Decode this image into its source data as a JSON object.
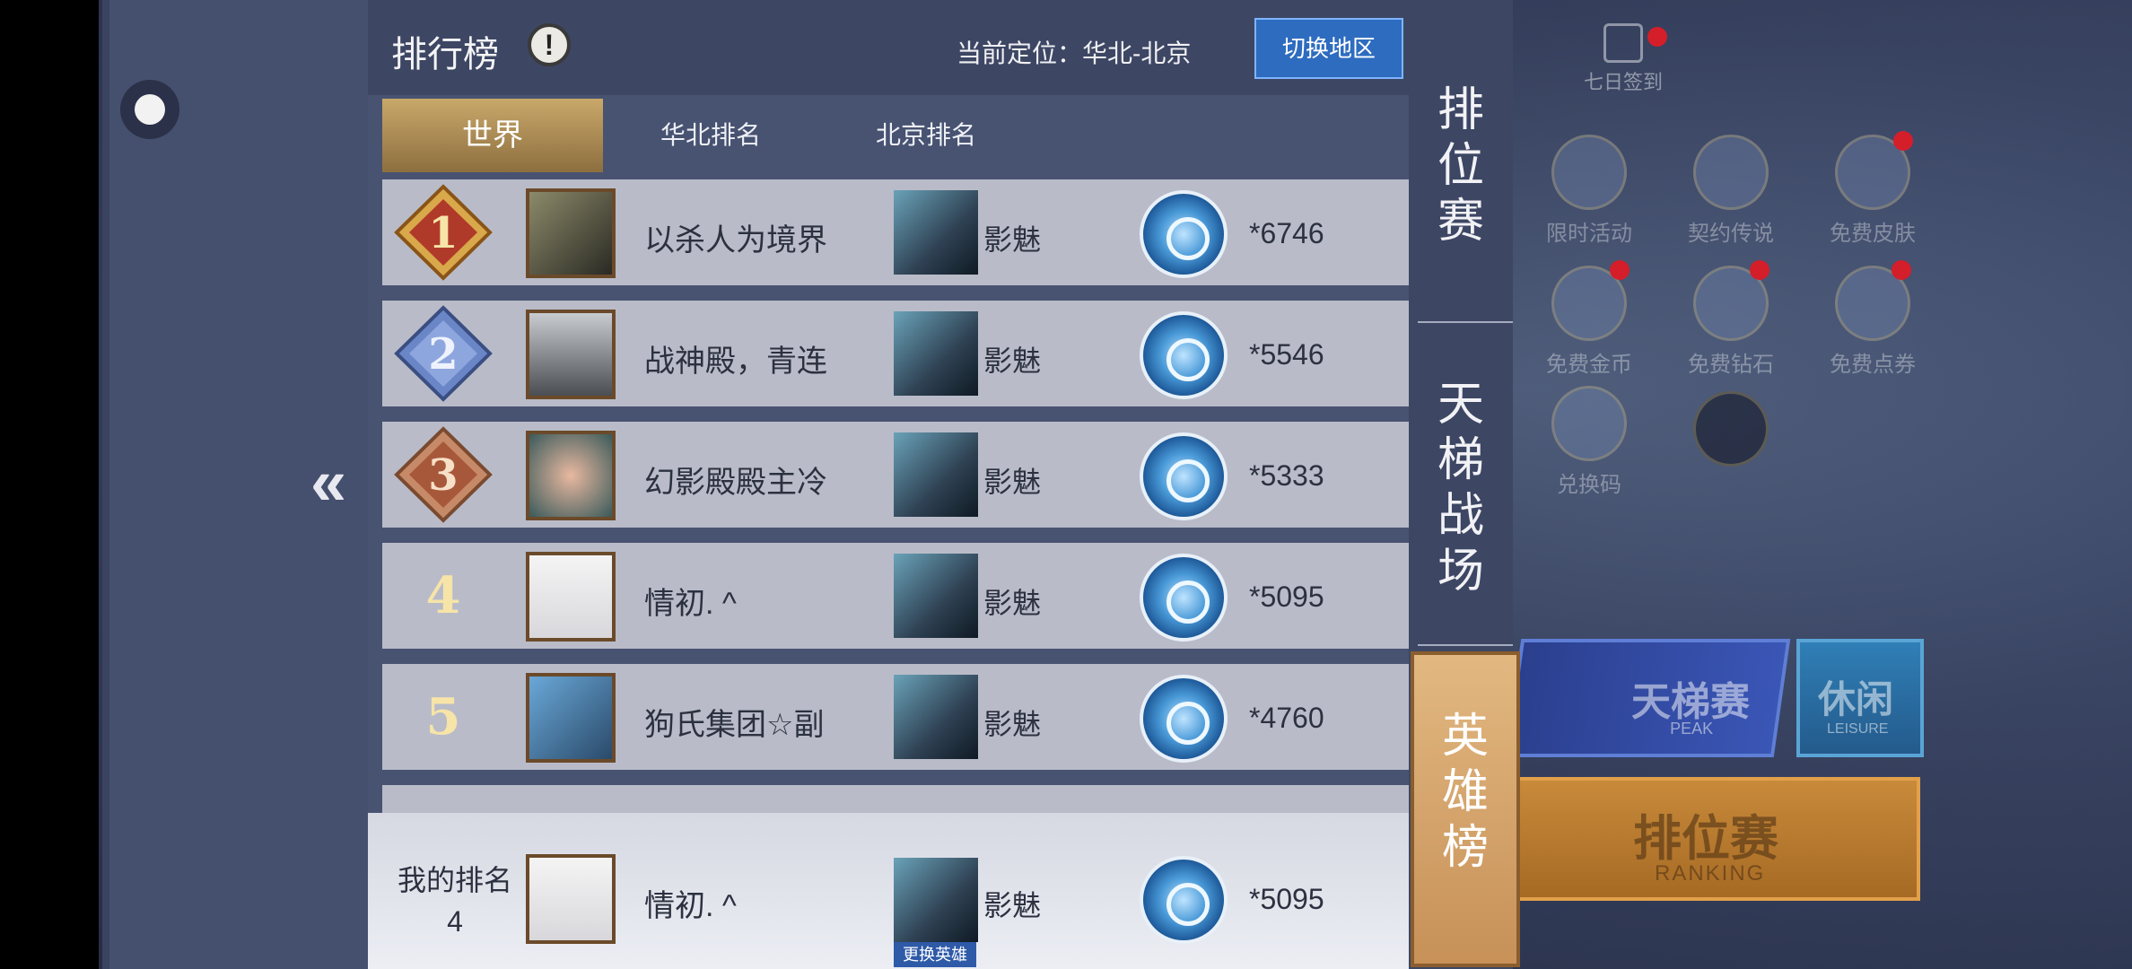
{
  "header": {
    "title": "排行榜",
    "info_icon": "!",
    "location": "当前定位：华北-北京",
    "switch_region": "切换地区"
  },
  "tabs": [
    {
      "label": "世界",
      "active": true
    },
    {
      "label": "华北排名",
      "active": false
    },
    {
      "label": "北京排名",
      "active": false
    }
  ],
  "rows": [
    {
      "rank": "1",
      "name": "以杀人为境界",
      "hero": "影魅",
      "score": "*6746"
    },
    {
      "rank": "2",
      "name": "战神殿，青连",
      "hero": "影魅",
      "score": "*5546"
    },
    {
      "rank": "3",
      "name": "幻影殿殿主冷",
      "hero": "影魅",
      "score": "*5333"
    },
    {
      "rank": "4",
      "name": "情初. ^",
      "hero": "影魅",
      "score": "*5095"
    },
    {
      "rank": "5",
      "name": "狗氏集团☆副",
      "hero": "影魅",
      "score": "*4760"
    }
  ],
  "my_rank": {
    "label_line1": "我的排名",
    "label_line2": "4",
    "name": "情初. ^",
    "hero": "影魅",
    "change_hero": "更换英雄",
    "score": "*5095"
  },
  "side_tabs": {
    "ranked": "排\n位\n赛",
    "ladder": "天\n梯\n战\n场",
    "heroes": "英\n雄\n榜"
  },
  "background_ui": {
    "sign_in": "七日签到",
    "icons": [
      "限时活动",
      "契约传说",
      "免费皮肤",
      "免费金币",
      "免费钻石",
      "免费点券",
      "兑换码"
    ],
    "ladder_btn": {
      "title": "天梯赛",
      "sub": "PEAK"
    },
    "leisure_btn": {
      "title": "休闲",
      "sub": "LEISURE"
    },
    "ranked_btn": {
      "title": "排位赛",
      "sub": "RANKING"
    }
  },
  "colors": {
    "accent_gold": "#c9a86a",
    "row_bg": "#b9bcc8",
    "switch_btn": "#2e6cc0"
  }
}
